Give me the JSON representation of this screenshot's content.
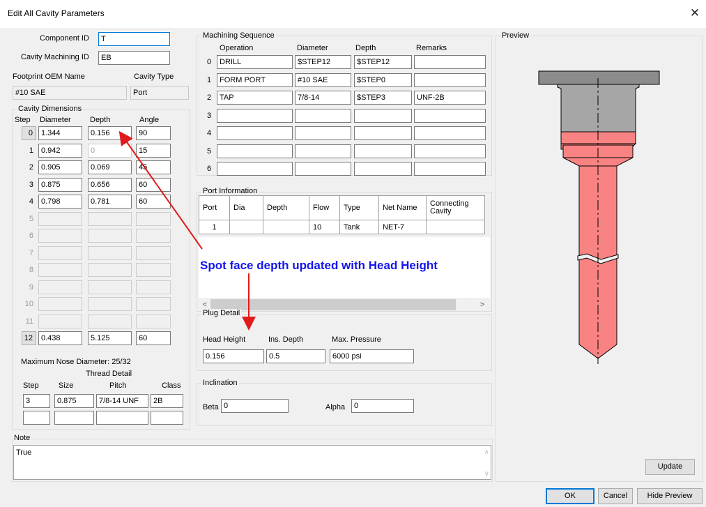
{
  "dialog": {
    "title": "Edit All Cavity Parameters",
    "close_label": "✕"
  },
  "identity": {
    "component_id_label": "Component ID",
    "component_id_value": "T",
    "cavity_machining_id_label": "Cavity Machining ID",
    "cavity_machining_id_value": "EB",
    "footprint_oem_label": "Footprint OEM Name",
    "footprint_oem_value": "#10 SAE",
    "cavity_type_label": "Cavity Type",
    "cavity_type_value": "Port"
  },
  "cavity_dimensions": {
    "title": "Cavity Dimensions",
    "headers": {
      "step": "Step",
      "diameter": "Diameter",
      "depth": "Depth",
      "angle": "Angle"
    },
    "rows": [
      {
        "step": "0",
        "diameter": "1.344",
        "depth": "0.156",
        "angle": "90"
      },
      {
        "step": "1",
        "diameter": "0.942",
        "depth": "0",
        "angle": "15"
      },
      {
        "step": "2",
        "diameter": "0.905",
        "depth": "0.069",
        "angle": "45"
      },
      {
        "step": "3",
        "diameter": "0.875",
        "depth": "0.656",
        "angle": "60"
      },
      {
        "step": "4",
        "diameter": "0.798",
        "depth": "0.781",
        "angle": "60"
      },
      {
        "step": "5",
        "diameter": "",
        "depth": "",
        "angle": ""
      },
      {
        "step": "6",
        "diameter": "",
        "depth": "",
        "angle": ""
      },
      {
        "step": "7",
        "diameter": "",
        "depth": "",
        "angle": ""
      },
      {
        "step": "8",
        "diameter": "",
        "depth": "",
        "angle": ""
      },
      {
        "step": "9",
        "diameter": "",
        "depth": "",
        "angle": ""
      },
      {
        "step": "10",
        "diameter": "",
        "depth": "",
        "angle": ""
      },
      {
        "step": "11",
        "diameter": "",
        "depth": "",
        "angle": ""
      },
      {
        "step": "12",
        "diameter": "0.438",
        "depth": "5.125",
        "angle": "60"
      }
    ],
    "max_nose_diameter": "Maximum Nose Diameter: 25/32"
  },
  "thread_detail": {
    "title": "Thread Detail",
    "headers": {
      "step": "Step",
      "size": "Size",
      "pitch": "Pitch",
      "class": "Class"
    },
    "row1": {
      "step": "3",
      "size": "0.875",
      "pitch": "7/8-14 UNF",
      "class": "2B"
    }
  },
  "machining_sequence": {
    "title": "Machining Sequence",
    "headers": {
      "operation": "Operation",
      "diameter": "Diameter",
      "depth": "Depth",
      "remarks": "Remarks"
    },
    "rows": [
      {
        "idx": "0",
        "operation": "DRILL",
        "diameter": "$STEP12",
        "depth": "$STEP12",
        "remarks": ""
      },
      {
        "idx": "1",
        "operation": "FORM PORT",
        "diameter": "#10 SAE",
        "depth": "$STEP0",
        "remarks": ""
      },
      {
        "idx": "2",
        "operation": "TAP",
        "diameter": "7/8-14",
        "depth": "$STEP3",
        "remarks": "UNF-2B"
      },
      {
        "idx": "3",
        "operation": "",
        "diameter": "",
        "depth": "",
        "remarks": ""
      },
      {
        "idx": "4",
        "operation": "",
        "diameter": "",
        "depth": "",
        "remarks": ""
      },
      {
        "idx": "5",
        "operation": "",
        "diameter": "",
        "depth": "",
        "remarks": ""
      },
      {
        "idx": "6",
        "operation": "",
        "diameter": "",
        "depth": "",
        "remarks": ""
      }
    ]
  },
  "port_information": {
    "title": "Port Information",
    "headers": [
      "Port",
      "Dia",
      "Depth",
      "Flow",
      "Type",
      "Net Name",
      "Connecting Cavity"
    ],
    "rows": [
      [
        "1",
        "",
        "",
        "10",
        "Tank",
        "NET-7",
        ""
      ]
    ]
  },
  "plug_detail": {
    "title": "Plug Detail",
    "head_height_label": "Head Height",
    "head_height_value": "0.156",
    "ins_depth_label": "Ins. Depth",
    "ins_depth_value": "0.5",
    "max_pressure_label": "Max. Pressure",
    "max_pressure_value": "6000 psi"
  },
  "inclination": {
    "title": "Inclination",
    "beta_label": "Beta",
    "beta_value": "0",
    "alpha_label": "Alpha",
    "alpha_value": "0"
  },
  "note": {
    "title": "Note",
    "value": "True"
  },
  "preview": {
    "title": "Preview",
    "update_label": "Update"
  },
  "annotation": {
    "text": "Spot face depth updated with Head Height",
    "color": "#1515ee",
    "arrow_color": "#e01b1b"
  },
  "footer": {
    "ok_label": "OK",
    "cancel_label": "Cancel",
    "hide_preview_label": "Hide Preview"
  },
  "colors": {
    "cavity_gray": "#a6a6a6",
    "cavity_red": "#f98383",
    "head_gray": "#8c8c8c"
  }
}
